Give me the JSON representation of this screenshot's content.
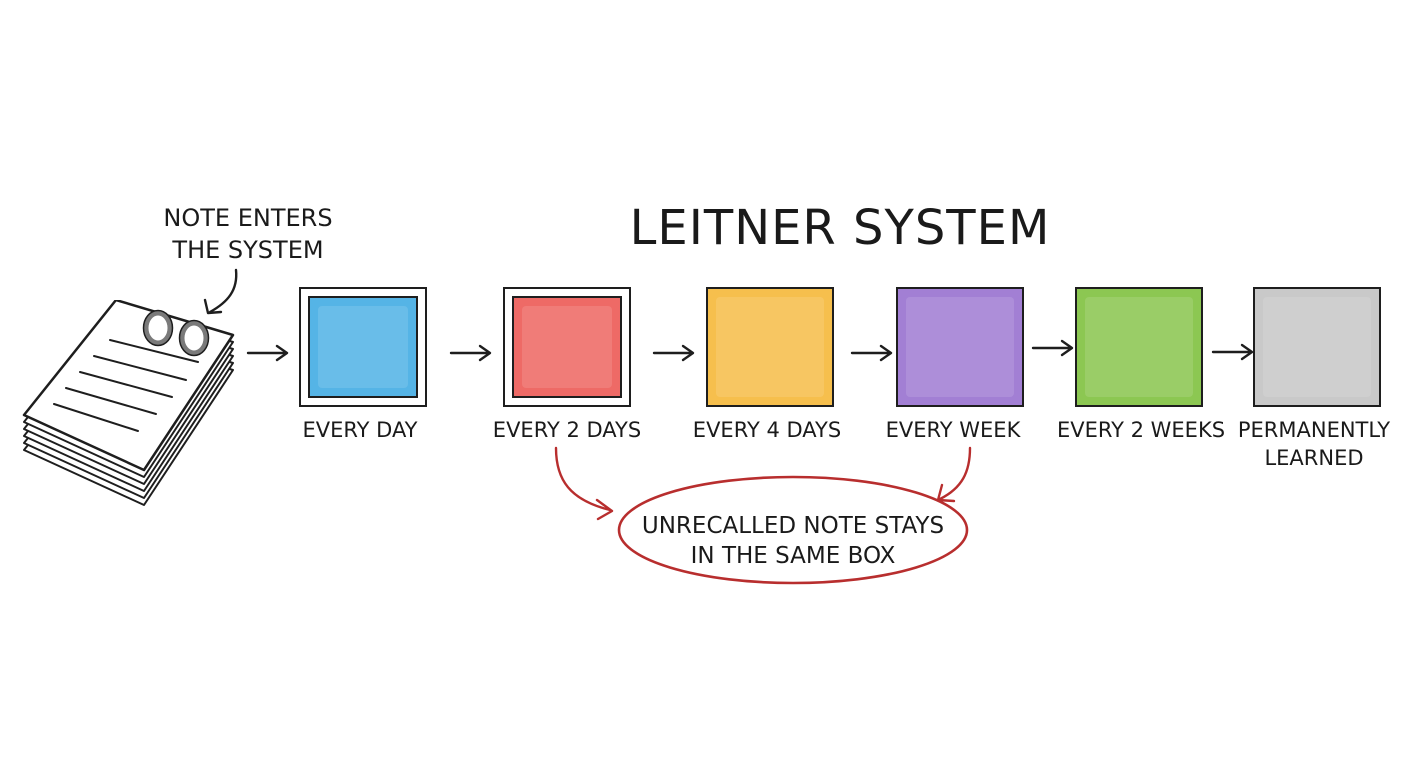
{
  "title": "LEITNER SYSTEM",
  "intro": {
    "line1": "NOTE ENTERS",
    "line2": "THE SYSTEM"
  },
  "boxes": [
    {
      "label": "EVERY DAY",
      "color": "#55b4e6"
    },
    {
      "label": "EVERY 2 DAYS",
      "color": "#ee6a66"
    },
    {
      "label": "EVERY 4 DAYS",
      "color": "#f6bf4d"
    },
    {
      "label": "EVERY WEEK",
      "color": "#a27fd4"
    },
    {
      "label": "EVERY 2 WEEKS",
      "color": "#8cc752"
    },
    {
      "label_line1": "PERMANENTLY",
      "label_line2": "LEARNED",
      "color": "#c9c9c9"
    }
  ],
  "note": {
    "line1": "UNRECALLED NOTE STAYS",
    "line2": "IN THE SAME BOX",
    "color": "#b82e2e"
  },
  "icons": [
    "notepad-icon",
    "arrow-icon",
    "curved-arrow-icon"
  ]
}
